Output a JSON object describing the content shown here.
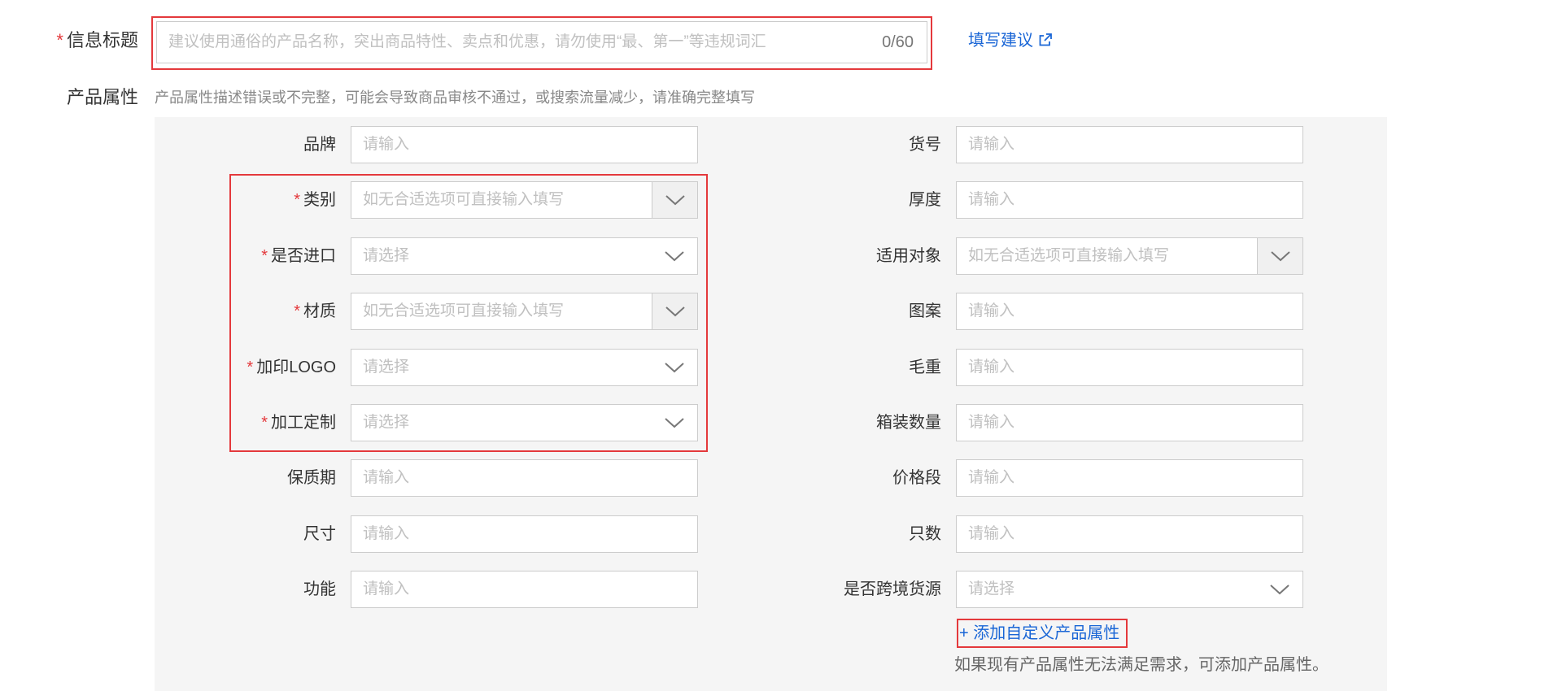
{
  "title_row": {
    "label": "信息标题",
    "placeholder": "建议使用通俗的产品名称，突出商品特性、卖点和优惠，请勿使用“最、第一”等违规词汇",
    "value": "",
    "char_count": "0/60",
    "suggest_link": "填写建议",
    "suggest_icon": "external-link-icon"
  },
  "attributes": {
    "label": "产品属性",
    "hint": "产品属性描述错误或不完整，可能会导致商品审核不通过，或搜索流量减少，请准确完整填写",
    "left_fields": [
      {
        "label": "品牌",
        "required": false,
        "type": "input",
        "placeholder": "请输入"
      },
      {
        "label": "类别",
        "required": true,
        "type": "combo",
        "placeholder": "如无合适选项可直接输入填写"
      },
      {
        "label": "是否进口",
        "required": true,
        "type": "select",
        "placeholder": "请选择"
      },
      {
        "label": "材质",
        "required": true,
        "type": "combo",
        "placeholder": "如无合适选项可直接输入填写"
      },
      {
        "label": "加印LOGO",
        "required": true,
        "type": "select",
        "placeholder": "请选择"
      },
      {
        "label": "加工定制",
        "required": true,
        "type": "select",
        "placeholder": "请选择"
      },
      {
        "label": "保质期",
        "required": false,
        "type": "input",
        "placeholder": "请输入"
      },
      {
        "label": "尺寸",
        "required": false,
        "type": "input",
        "placeholder": "请输入"
      },
      {
        "label": "功能",
        "required": false,
        "type": "input",
        "placeholder": "请输入"
      }
    ],
    "right_fields": [
      {
        "label": "货号",
        "required": false,
        "type": "input",
        "placeholder": "请输入"
      },
      {
        "label": "厚度",
        "required": false,
        "type": "input",
        "placeholder": "请输入"
      },
      {
        "label": "适用对象",
        "required": false,
        "type": "combo",
        "placeholder": "如无合适选项可直接输入填写"
      },
      {
        "label": "图案",
        "required": false,
        "type": "input",
        "placeholder": "请输入"
      },
      {
        "label": "毛重",
        "required": false,
        "type": "input",
        "placeholder": "请输入"
      },
      {
        "label": "箱装数量",
        "required": false,
        "type": "input",
        "placeholder": "请输入"
      },
      {
        "label": "价格段",
        "required": false,
        "type": "input",
        "placeholder": "请输入"
      },
      {
        "label": "只数",
        "required": false,
        "type": "input",
        "placeholder": "请输入"
      },
      {
        "label": "是否跨境货源",
        "required": false,
        "type": "select",
        "placeholder": "请选择"
      }
    ],
    "add_custom": "+ 添加自定义产品属性",
    "add_note": "如果现有产品属性无法满足需求，可添加产品属性。"
  },
  "colors": {
    "required_star": "#e4393c",
    "highlight_border": "#e4393c",
    "link": "#1a66d6",
    "panel_bg": "#f5f5f5"
  },
  "required_mark": "*"
}
